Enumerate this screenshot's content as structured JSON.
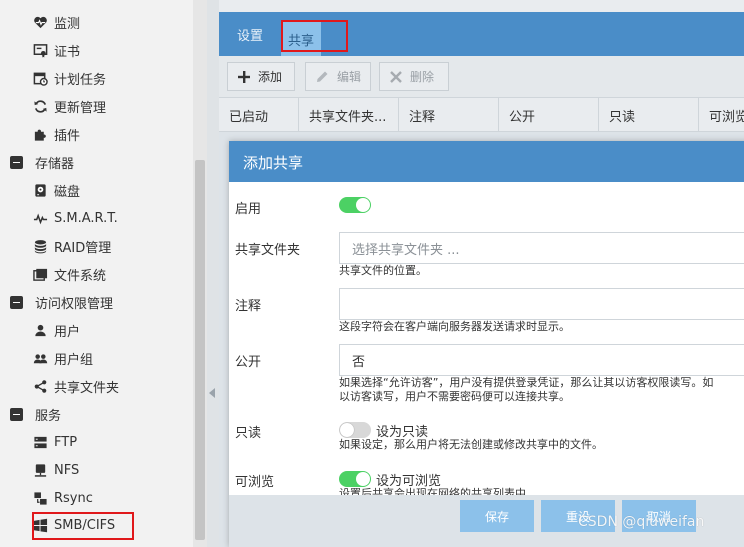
{
  "sidebar": {
    "items": [
      {
        "label": "监测",
        "icon": "heartbeat-icon",
        "kind": "child"
      },
      {
        "label": "证书",
        "icon": "certificate-icon",
        "kind": "child"
      },
      {
        "label": "计划任务",
        "icon": "calendar-clock-icon",
        "kind": "child"
      },
      {
        "label": "更新管理",
        "icon": "refresh-icon",
        "kind": "child"
      },
      {
        "label": "插件",
        "icon": "puzzle-icon",
        "kind": "child"
      },
      {
        "label": "存储器",
        "icon": "collapse-minus-icon",
        "kind": "group"
      },
      {
        "label": "磁盘",
        "icon": "disk-icon",
        "kind": "child"
      },
      {
        "label": "S.M.A.R.T.",
        "icon": "pulse-icon",
        "kind": "child"
      },
      {
        "label": "RAID管理",
        "icon": "database-icon",
        "kind": "child"
      },
      {
        "label": "文件系统",
        "icon": "folders-icon",
        "kind": "child"
      },
      {
        "label": "访问权限管理",
        "icon": "collapse-minus-icon",
        "kind": "group"
      },
      {
        "label": "用户",
        "icon": "user-icon",
        "kind": "child"
      },
      {
        "label": "用户组",
        "icon": "users-icon",
        "kind": "child"
      },
      {
        "label": "共享文件夹",
        "icon": "share-icon",
        "kind": "child"
      },
      {
        "label": "服务",
        "icon": "collapse-minus-icon",
        "kind": "group"
      },
      {
        "label": "FTP",
        "icon": "server-icon",
        "kind": "child"
      },
      {
        "label": "NFS",
        "icon": "nfs-icon",
        "kind": "child"
      },
      {
        "label": "Rsync",
        "icon": "rsync-icon",
        "kind": "child"
      },
      {
        "label": "SMB/CIFS",
        "icon": "windows-icon",
        "kind": "child"
      }
    ]
  },
  "tabs": [
    {
      "label": "设置",
      "active": false
    },
    {
      "label": "共享",
      "active": true
    }
  ],
  "toolbar": {
    "add_label": "添加",
    "edit_label": "编辑",
    "delete_label": "删除"
  },
  "grid": {
    "columns": [
      "已启动",
      "共享文件夹...",
      "注释",
      "公开",
      "只读",
      "可浏览"
    ]
  },
  "dialog": {
    "title": "添加共享",
    "fields": {
      "enable": {
        "label": "启用",
        "on": true
      },
      "shared_folder": {
        "label": "共享文件夹",
        "placeholder": "选择共享文件夹 ...",
        "hint": "共享文件的位置。"
      },
      "comment": {
        "label": "注释",
        "value": "",
        "hint": "这段字符会在客户端向服务器发送请求时显示。"
      },
      "public": {
        "label": "公开",
        "value": "否",
        "hint_line1": "如果选择“允许访客”，用户没有提供登录凭证，那么让其以访客权限读写。如",
        "hint_line2": "以访客读写，用户不需要密码便可以连接共享。"
      },
      "readonly": {
        "label": "只读",
        "on": false,
        "toggle_text": "设为只读",
        "hint": "如果设定，那么用户将无法创建或修改共享中的文件。"
      },
      "browseable": {
        "label": "可浏览",
        "on": true,
        "toggle_text": "设为可浏览",
        "hint": "设置后共享会出现在网络的共享列表中"
      }
    },
    "buttons": {
      "save": "保存",
      "reset": "重设",
      "cancel": "取消"
    }
  },
  "watermark": "CSDN @qiuweifan",
  "colors": {
    "accent": "#4a8dc8",
    "active_tab": "#8cc1ea",
    "toggle_on": "#4cd164",
    "highlight": "#e0181b"
  }
}
